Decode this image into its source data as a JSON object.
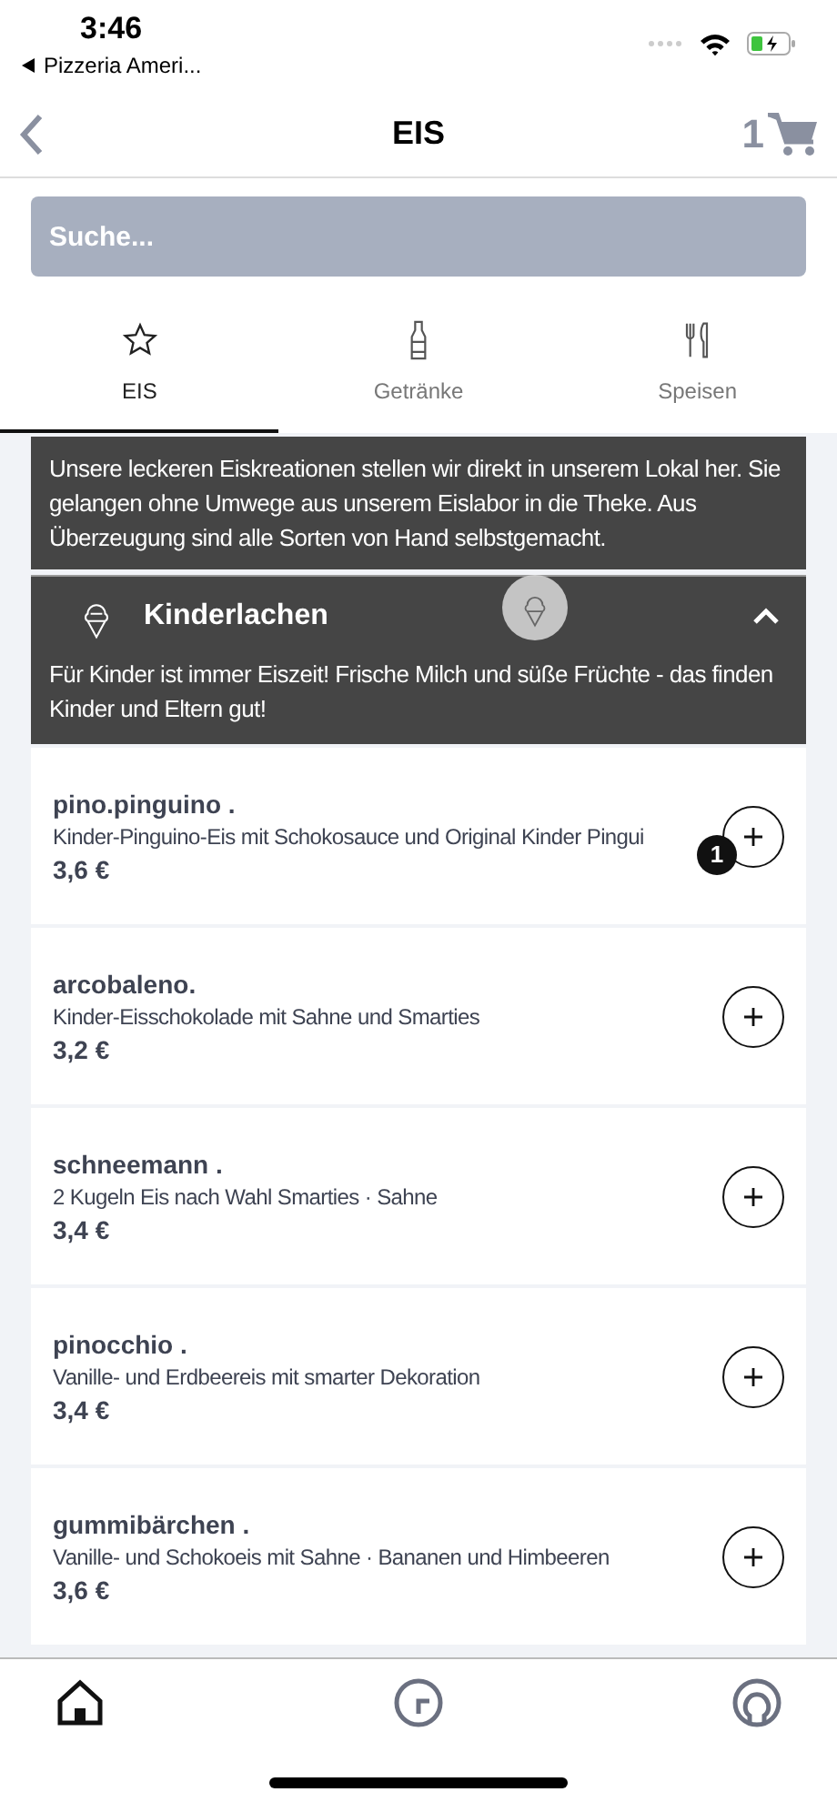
{
  "status_bar": {
    "time": "3:46",
    "back_app": "Pizzeria Ameri..."
  },
  "nav": {
    "title": "EIS",
    "cart_count": "1"
  },
  "search": {
    "placeholder": "Suche..."
  },
  "tabs": [
    {
      "label": "EIS",
      "selected": true
    },
    {
      "label": "Getränke",
      "selected": false
    },
    {
      "label": "Speisen",
      "selected": false
    }
  ],
  "intro": "Unsere leckeren Eiskreationen stellen wir direkt in unserem Lokal her. Sie gelangen ohne Umwege aus unserem Eislabor in die Theke. Aus Überzeugung sind alle Sorten von Hand selbstgemacht.",
  "category": {
    "title": "Kinderlachen",
    "description": "Für Kinder ist immer Eiszeit! Frische Milch und süße Früchte - das finden Kinder und Eltern gut!",
    "expanded": true
  },
  "items": [
    {
      "name": "pino.pinguino .",
      "description": "Kinder-Pinguino-Eis mit  Schokosauce und Original  Kinder Pingui",
      "price": "3,6 €",
      "badge": "1"
    },
    {
      "name": "arcobaleno.",
      "description": "Kinder-Eisschokolade  mit Sahne und Smarties",
      "price": "3,2 €"
    },
    {
      "name": "schneemann .",
      "description": "2 Kugeln Eis nach Wahl  Smarties · Sahne",
      "price": "3,4 €"
    },
    {
      "name": "pinocchio .",
      "description": "Vanille- und Erdbeereis  mit smarter Dekoration",
      "price": "3,4 €"
    },
    {
      "name": "gummibärchen .",
      "description": "Vanille- und  Schokoeis mit Sahne · Bananen  und Himbeeren",
      "price": "3,6 €"
    }
  ],
  "bottom_nav": [
    {
      "selected": true
    },
    {
      "selected": false
    },
    {
      "selected": false
    }
  ]
}
